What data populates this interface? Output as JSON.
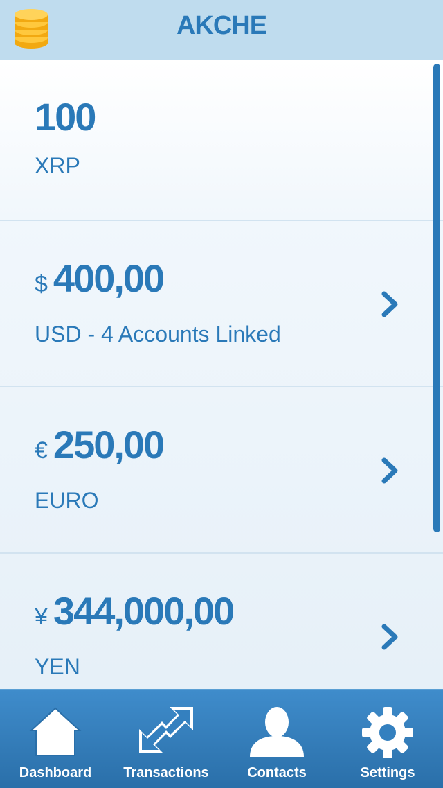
{
  "header": {
    "title": "AKCHE",
    "logo_icon": "gold-coins-icon"
  },
  "balances": [
    {
      "symbol": "",
      "amount": "100",
      "label": "XRP",
      "has_chevron": false
    },
    {
      "symbol": "$",
      "amount": "400,00",
      "label": "USD - 4 Accounts Linked",
      "has_chevron": true
    },
    {
      "symbol": "€",
      "amount": "250,00",
      "label": "EURO",
      "has_chevron": true
    },
    {
      "symbol": "¥",
      "amount": "344,000,00",
      "label": "YEN",
      "has_chevron": true
    }
  ],
  "tabs": [
    {
      "label": "Dashboard",
      "icon": "house-icon"
    },
    {
      "label": "Transactions",
      "icon": "arrows-exchange-icon"
    },
    {
      "label": "Contacts",
      "icon": "person-icon"
    },
    {
      "label": "Settings",
      "icon": "gear-icon"
    }
  ],
  "colors": {
    "accent": "#2a79b8",
    "header_bg": "#bfdcee",
    "tabbar_bg": "#3480bf"
  }
}
